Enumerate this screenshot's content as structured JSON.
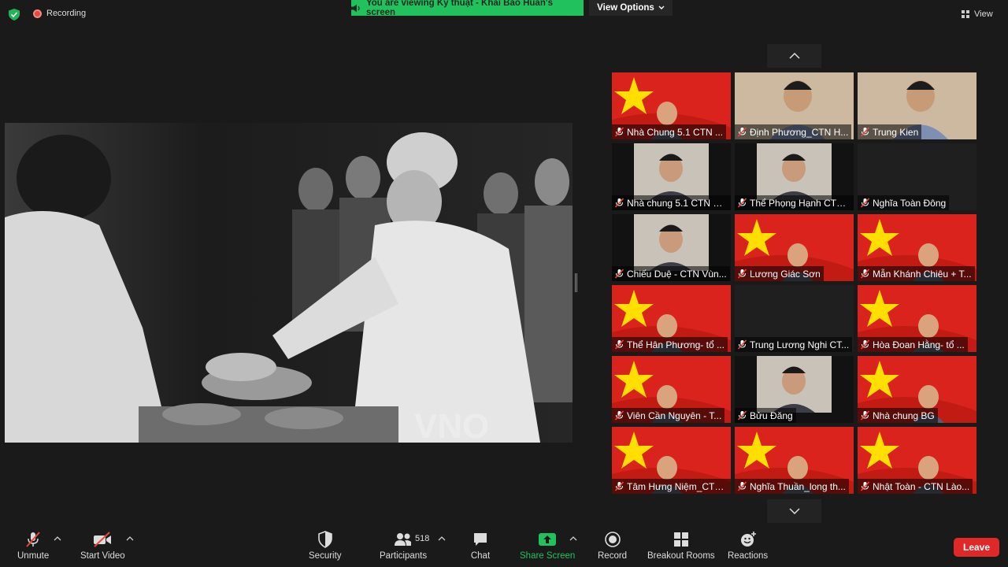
{
  "top_bar": {
    "recording_label": "Recording",
    "viewing_banner": "You are viewing Kỹ thuật - Khải Bảo Huấn's screen",
    "view_options_label": "View Options",
    "view_label": "View"
  },
  "shared_screen": {
    "watermark": "VNO"
  },
  "participants": [
    {
      "name": "Nhà Chung 5.1 CTN ...",
      "background": "flag"
    },
    {
      "name": "Định Phương_CTN H...",
      "background": "room"
    },
    {
      "name": "Trung Kien",
      "background": "room"
    },
    {
      "name": "Nhà chung 5.1 CTN H...",
      "background": "video"
    },
    {
      "name": "Thể Phọng Hạnh CTN...",
      "background": "video"
    },
    {
      "name": "Nghĩa Toàn Đông",
      "background": "none"
    },
    {
      "name": "Chiếu Duệ - CTN Vùn...",
      "background": "video"
    },
    {
      "name": "Lương Giác Sơn",
      "background": "flag"
    },
    {
      "name": "Mẫn Khánh Chiêu + T...",
      "background": "flag"
    },
    {
      "name": "Thể Hân Phương- tổ ...",
      "background": "flag"
    },
    {
      "name": "Trung Lương Nghi CT...",
      "background": "none"
    },
    {
      "name": "Hòa Đoan Hằng- tổ ...",
      "background": "flag"
    },
    {
      "name": "Viên Cần Nguyên - T...",
      "background": "flag"
    },
    {
      "name": "Bửu Đăng",
      "background": "video"
    },
    {
      "name": "Nhà chung BG",
      "background": "flag"
    },
    {
      "name": "Tâm Hưng Niệm_CTN...",
      "background": "flag"
    },
    {
      "name": "Nghĩa Thuần_long th...",
      "background": "flag"
    },
    {
      "name": "Nhật Toàn - CTN Lào...",
      "background": "flag"
    }
  ],
  "toolbar": {
    "unmute": "Unmute",
    "start_video": "Start Video",
    "security": "Security",
    "participants": "Participants",
    "participants_count": "518",
    "chat": "Chat",
    "share_screen": "Share Screen",
    "record": "Record",
    "breakout_rooms": "Breakout Rooms",
    "reactions": "Reactions",
    "leave": "Leave"
  },
  "colors": {
    "banner_green": "#21c25e",
    "leave_red": "#e02828",
    "muted_red": "#e5483e",
    "flag_red": "#d9231c",
    "flag_star": "#ffde00"
  }
}
